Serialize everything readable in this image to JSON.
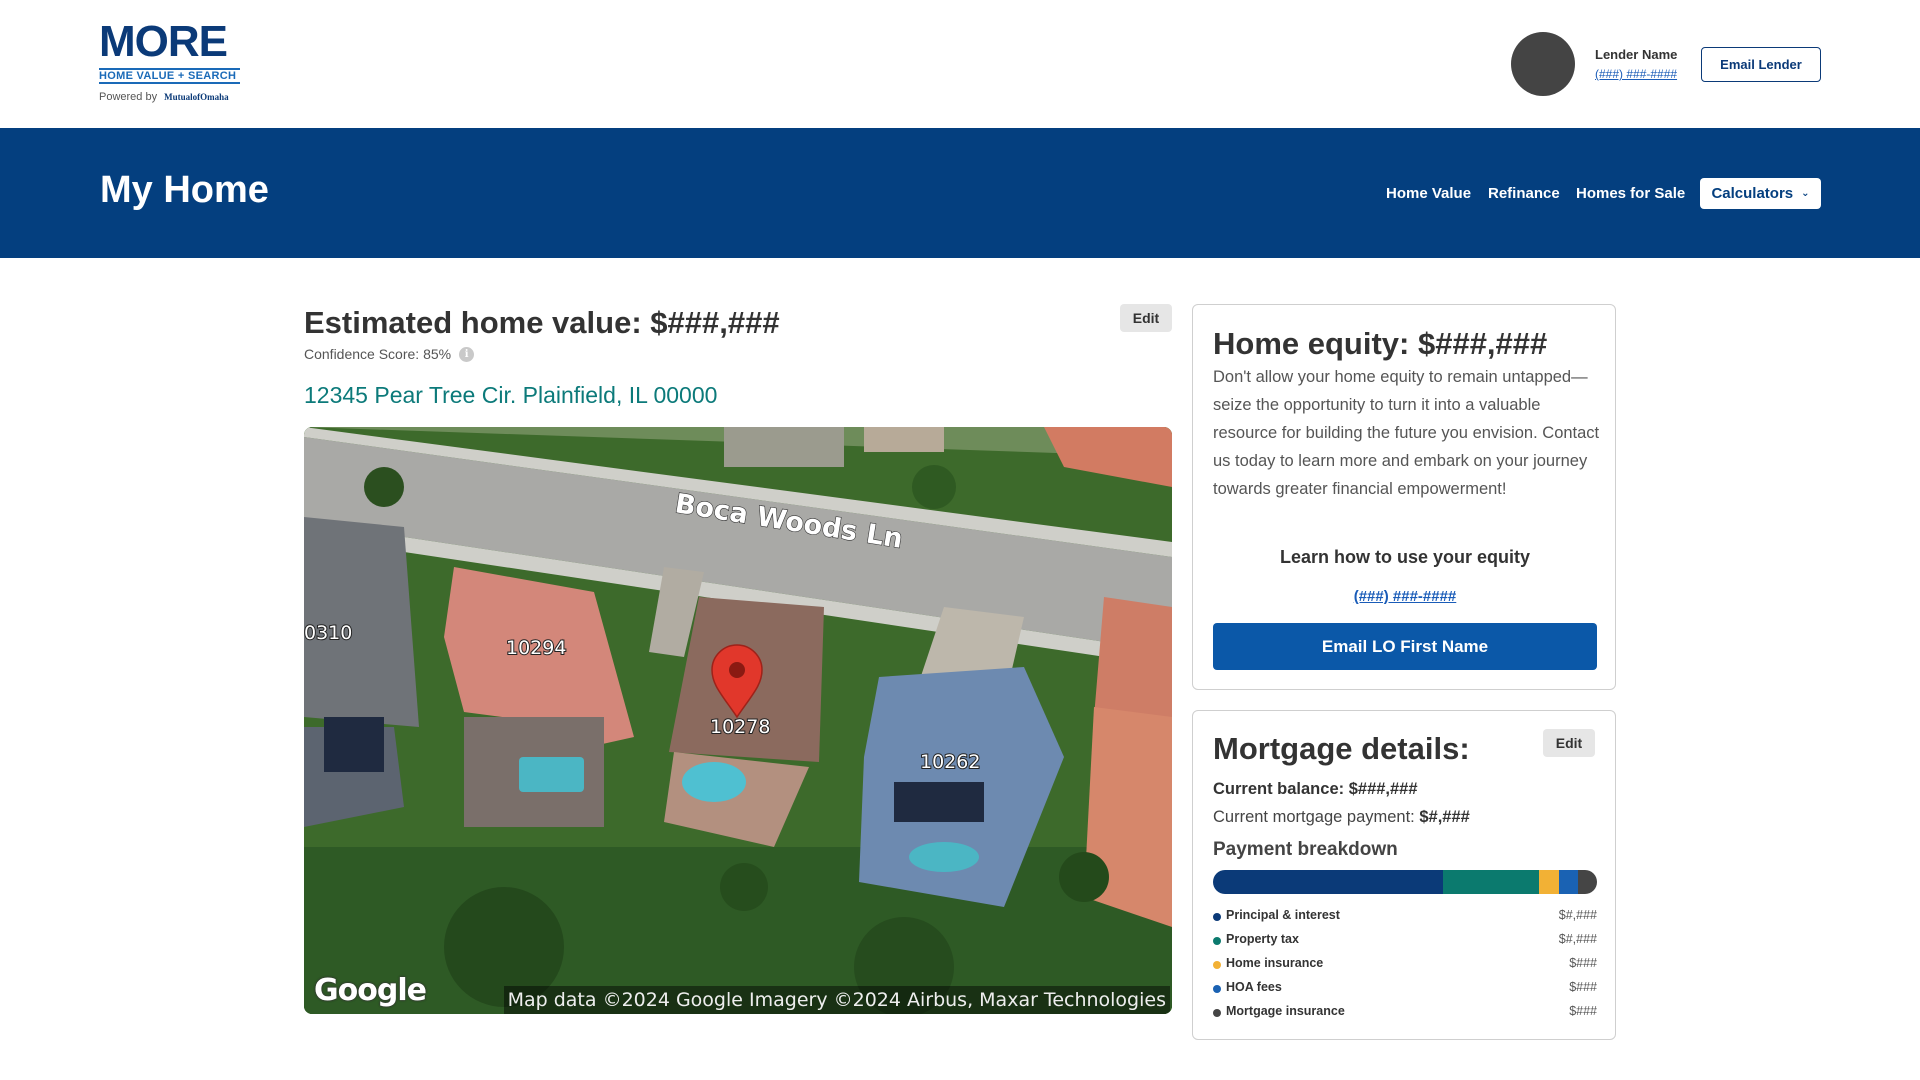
{
  "brand": {
    "logo_word": "MORE",
    "logo_sub": "HOME VALUE + SEARCH",
    "powered_by": "Powered by",
    "powered_brand": "MutualofOmaha"
  },
  "lender": {
    "name": "Lender Name",
    "phone": "(###) ###-####",
    "email_label": "Email Lender"
  },
  "nav": {
    "title": "My Home",
    "links": [
      "Home Value",
      "Refinance",
      "Homes for Sale"
    ],
    "calculators_label": "Calculators"
  },
  "estimate": {
    "title": "Estimated home value: $###,###",
    "edit_label": "Edit",
    "confidence": "Confidence Score: 85%",
    "address": "12345 Pear Tree Cir. Plainfield, IL 00000"
  },
  "map": {
    "street": "Boca Woods Ln",
    "house_numbers": [
      "0310",
      "10294",
      "10278",
      "10262"
    ],
    "google": "Google",
    "attribution": "Map data ©2024 Google Imagery ©2024 Airbus, Maxar Technologies"
  },
  "equity": {
    "title": "Home equity: $###,###",
    "body": "Don't allow your home equity to remain untapped—seize the opportunity to turn it into a valuable resource for building the future you envision. Contact us today to learn more and embark on your journey towards greater financial empowerment!",
    "learn": "Learn how to use your equity",
    "phone": "(###) ###-####",
    "email_label": "Email LO First Name"
  },
  "mortgage": {
    "title": "Mortgage details:",
    "edit_label": "Edit",
    "balance_label": "Current balance:",
    "balance_value": "$###,###",
    "payment_label": "Current mortgage payment:",
    "payment_value": "$#,###",
    "breakdown_title": "Payment breakdown",
    "breakdown": [
      {
        "label": "Principal & interest",
        "value": "$#,###",
        "color": "#0b3a78",
        "share": 0.6
      },
      {
        "label": "Property tax",
        "value": "$#,###",
        "color": "#0b7a6e",
        "share": 0.25
      },
      {
        "label": "Home insurance",
        "value": "$###",
        "color": "#f2b135",
        "share": 0.05
      },
      {
        "label": "HOA fees",
        "value": "$###",
        "color": "#1a62b3",
        "share": 0.05
      },
      {
        "label": "Mortgage insurance",
        "value": "$###",
        "color": "#454545",
        "share": 0.05
      }
    ]
  },
  "colors": {
    "nav_band": "#043f7f",
    "primary_button": "#0b58a8",
    "address": "#0c7a7a",
    "link": "#1a5cb8"
  }
}
